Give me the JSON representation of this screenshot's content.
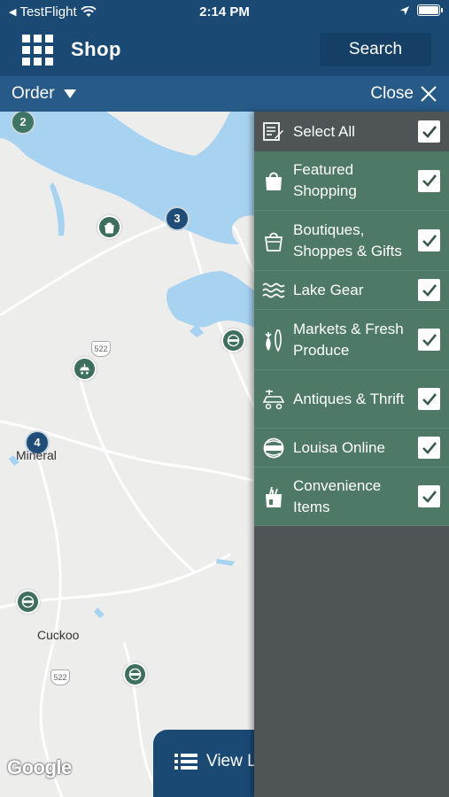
{
  "status_bar": {
    "back_app": "TestFlight",
    "time": "2:14 PM"
  },
  "header": {
    "title": "Shop",
    "search_label": "Search",
    "menu_icon": "grid-icon"
  },
  "subheader": {
    "order_label": "Order",
    "close_label": "Close"
  },
  "map": {
    "towns": [
      "Mineral",
      "Cuckoo"
    ],
    "route_shields": [
      "522",
      "522"
    ],
    "clusters": [
      "2",
      "3",
      "4"
    ],
    "attribution": "Google",
    "view_list_label": "View L"
  },
  "filters": {
    "select_all": {
      "label": "Select All",
      "checked": true,
      "icon": "list-edit-icon"
    },
    "categories": [
      {
        "label": "Featured Shopping",
        "checked": true,
        "icon": "shopping-bag-icon"
      },
      {
        "label": "Boutiques, Shoppes & Gifts",
        "checked": true,
        "icon": "gift-bag-icon"
      },
      {
        "label": "Lake Gear",
        "checked": true,
        "icon": "waves-icon"
      },
      {
        "label": "Markets & Fresh Produce",
        "checked": true,
        "icon": "produce-icon"
      },
      {
        "label": "Antiques & Thrift",
        "checked": true,
        "icon": "antique-cart-icon"
      },
      {
        "label": "Louisa Online",
        "checked": true,
        "icon": "www-globe-icon"
      },
      {
        "label": "Convenience Items",
        "checked": true,
        "icon": "grocery-bag-icon"
      }
    ]
  },
  "colors": {
    "header": "#1a4a74",
    "subheader": "#275a87",
    "category_green": "#4e7967",
    "panel_gray": "#4f5556",
    "map_bg": "#ededec",
    "water": "#a8d3f0"
  }
}
